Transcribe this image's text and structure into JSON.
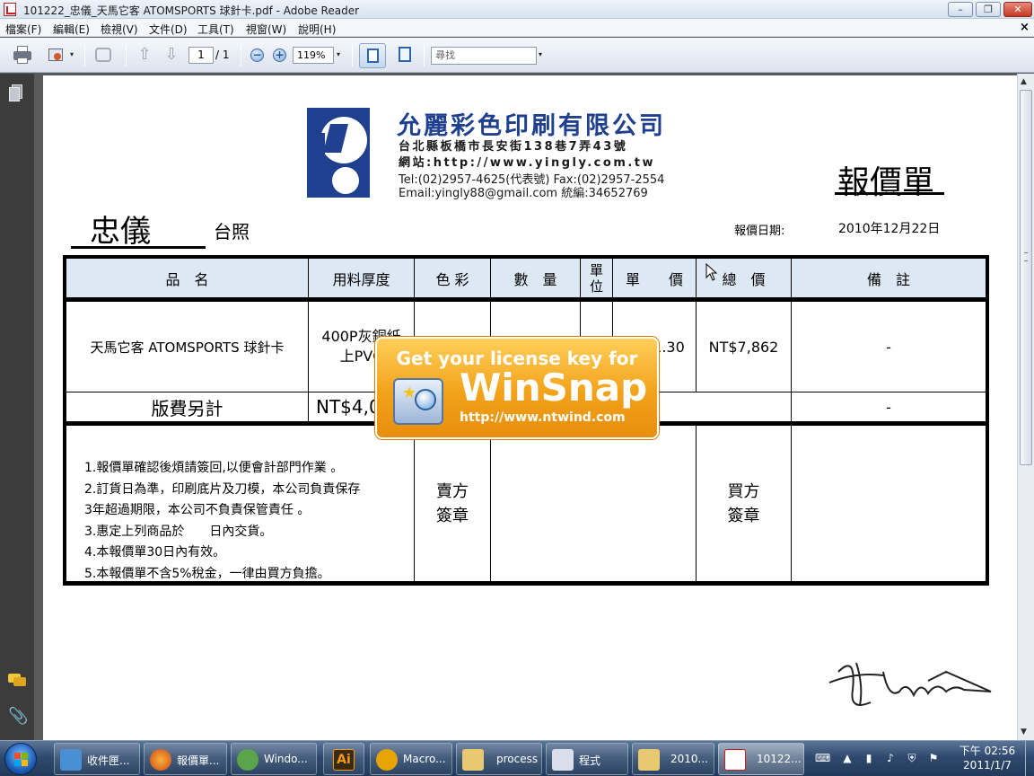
{
  "window": {
    "title": "101222_忠儀_天馬它客 ATOMSPORTS 球針卡.pdf - Adobe Reader",
    "min_glyph": "–",
    "max_glyph": "❐",
    "close_glyph": "✕"
  },
  "menu": {
    "items": [
      "檔案(F)",
      "編輯(E)",
      "檢視(V)",
      "文件(D)",
      "工具(T)",
      "視窗(W)",
      "說明(H)"
    ],
    "close_doc": "×"
  },
  "toolbar": {
    "page_current": "1",
    "page_total": "/ 1",
    "zoom": "119%",
    "search_placeholder": "尋找",
    "up_arrow": "⇧",
    "down_arrow": "⇩",
    "zoom_out": "−",
    "zoom_in": "+",
    "dropdown": "▾"
  },
  "leftnav": {
    "clip_glyph": "📎"
  },
  "document": {
    "company": {
      "name": "允麗彩色印刷有限公司",
      "address": "台北縣板橋市長安街138巷7弄43號",
      "website": "網站:http://www.yingly.com.tw",
      "tel": "Tel:(02)2957-4625(代表號)   Fax:(02)2957-2554",
      "email": "Email:yingly88@gmail.com       統編:34652769"
    },
    "doc_title": "報價單",
    "customer": "忠儀",
    "customer_note": "台照",
    "date_label": "報價日期:",
    "date_value": "2010年12月22日",
    "table": {
      "headers": [
        "品　名",
        "用料厚度",
        "色 彩",
        "數　量",
        "單位",
        "單　　價",
        "總　價",
        "備　註"
      ],
      "row1": {
        "name": "天馬它客 ATOMSPORTS 球針卡",
        "material": "400P灰銅紙上PVC",
        "unit_price": "NT$1.30",
        "total": "NT$7,862",
        "note": "-"
      },
      "row2": {
        "name": "版費另計",
        "amount": "NT$4,000",
        "note": "-"
      },
      "terms": [
        "1.報價單確認後煩請簽回,以便會計部門作業 。",
        "2.訂貨日為準，印刷底片及刀模，本公司負責保存",
        "3年超過期限，本公司不負責保管責任 。",
        "3.惠定上列商品於　　日內交貨。",
        "4.本報價單30日內有效。",
        "5.本報價單不含5%稅金，一律由買方負擔。"
      ],
      "seller_sign": "賣方\n簽章",
      "buyer_sign": "買方\n簽章"
    }
  },
  "overlay": {
    "line1": "Get your license key for",
    "line2": "WinSnap",
    "line3": "http://www.ntwind.com"
  },
  "scroll": {
    "up": "▲",
    "down": "▼"
  },
  "taskbar": {
    "items": [
      {
        "label": "收件匣...",
        "color": "#4a8fd4"
      },
      {
        "label": "報價單...",
        "color": "#e0641c"
      },
      {
        "label": "Windo...",
        "color": "#5aa54a"
      },
      {
        "label": "",
        "color": "#3a2a10"
      },
      {
        "label": "Macro...",
        "color": "#e6a400"
      },
      {
        "label": "process",
        "color": "#e8c870"
      },
      {
        "label": "程式",
        "color": "#d9dee8"
      },
      {
        "label": "2010...",
        "color": "#e8c870"
      },
      {
        "label": "10122...",
        "color": "#c81d1d"
      }
    ],
    "ai_label": "Ai",
    "clock_time": "下午 02:56",
    "clock_date": "2011/1/7"
  }
}
